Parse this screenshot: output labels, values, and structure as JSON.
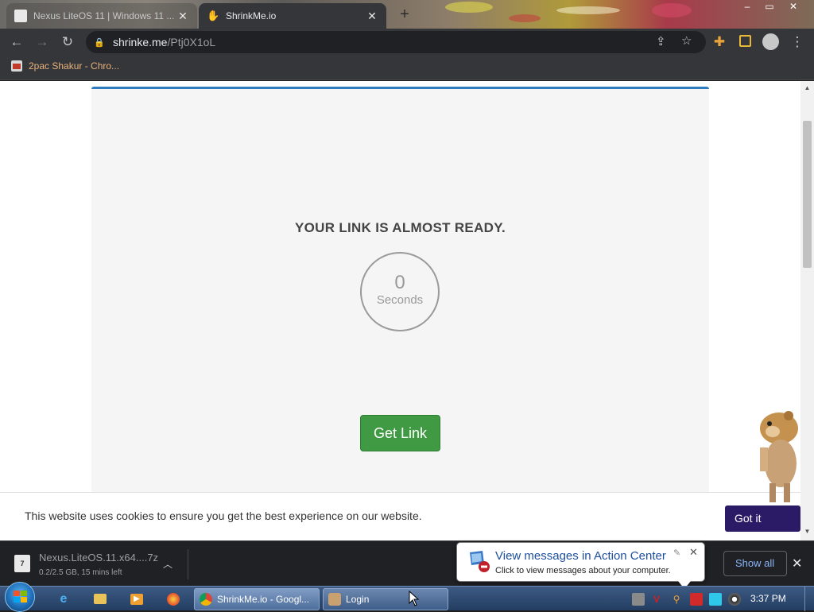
{
  "browser": {
    "tabs": [
      {
        "title": "Nexus LiteOS 11 | Windows 11 ...",
        "active": false
      },
      {
        "title": "ShrinkMe.io",
        "active": true
      }
    ],
    "new_tab_glyph": "+",
    "window_controls": [
      "–",
      "▭",
      "✕"
    ],
    "url_host": "shrinke.me",
    "url_path": "/Ptj0X1oL",
    "bookmarks": [
      {
        "label": "2pac Shakur - Chro..."
      }
    ]
  },
  "page": {
    "headline": "YOUR LINK IS ALMOST READY.",
    "countdown_value": "0",
    "countdown_unit": "Seconds",
    "get_link_label": "Get Link",
    "accent_color": "#3f9a43",
    "card_border_color": "#2e7bbd",
    "cookie_text": "This website uses cookies to ensure you get the best experience on our website.",
    "cookie_button": "Got it"
  },
  "downloads": {
    "file_name": "Nexus.LiteOS.11.x64....7z",
    "status": "0.2/2.5 GB, 15 mins left",
    "show_all_label": "Show all"
  },
  "notification": {
    "title": "View messages in Action Center",
    "body": "Click to view messages about your computer."
  },
  "taskbar": {
    "tasks": [
      {
        "label": "ShrinkMe.io - Googl..."
      },
      {
        "label": "Login"
      }
    ],
    "clock": "3:37 PM"
  }
}
